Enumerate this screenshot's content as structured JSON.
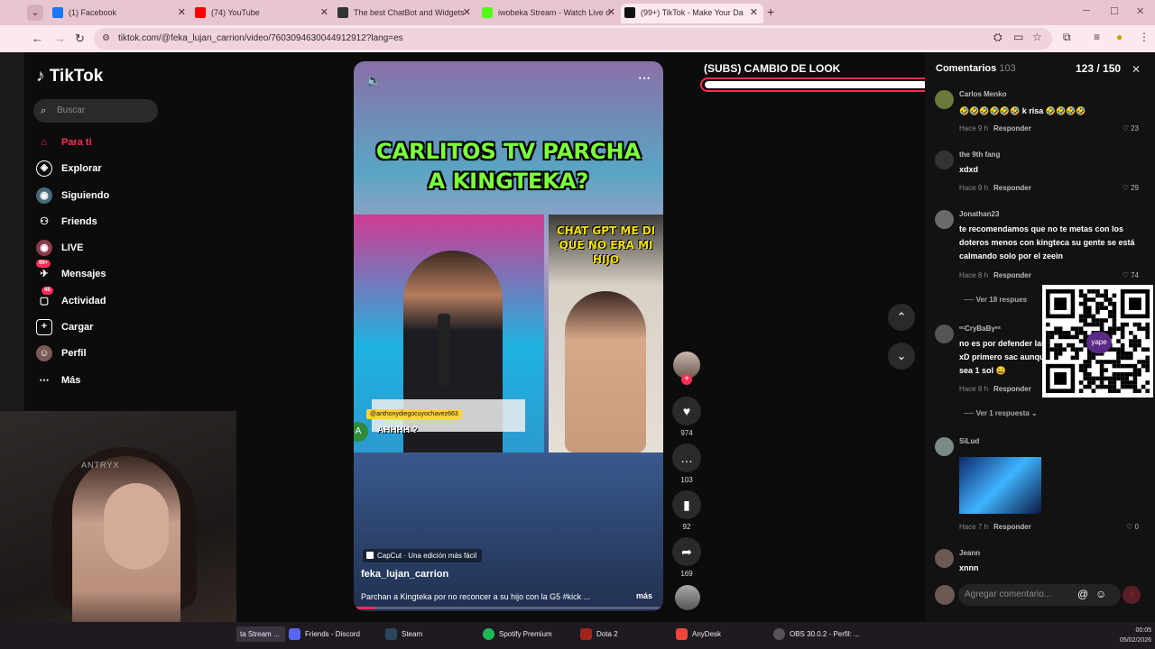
{
  "browser": {
    "tabs": [
      {
        "title": "(1) Facebook",
        "color": "#1877f2"
      },
      {
        "title": "(74) YouTube",
        "color": "#ff0000"
      },
      {
        "title": "The best ChatBot and Widgets",
        "color": "#333333"
      },
      {
        "title": "iwobeka Stream - Watch Live o",
        "color": "#53fc18"
      },
      {
        "title": "(99+) TikTok - Make Your Da",
        "color": "#111111"
      }
    ],
    "url": "tiktok.com/@feka_lujan_carrion/video/7603094630044912912?lang=es"
  },
  "sidebar": {
    "logo": "TikTok",
    "search_placeholder": "Buscar",
    "items": [
      {
        "label": "Para ti",
        "icon": "home-icon"
      },
      {
        "label": "Explorar",
        "icon": "compass-icon"
      },
      {
        "label": "Siguiendo",
        "icon": "following-icon"
      },
      {
        "label": "Friends",
        "icon": "friends-icon"
      },
      {
        "label": "LIVE",
        "icon": "live-icon"
      },
      {
        "label": "Mensajes",
        "icon": "messages-icon",
        "badge": "99+"
      },
      {
        "label": "Actividad",
        "icon": "activity-icon",
        "badge": "45"
      },
      {
        "label": "Cargar",
        "icon": "upload-icon"
      },
      {
        "label": "Perfil",
        "icon": "profile-icon"
      },
      {
        "label": "Más",
        "icon": "more-icon"
      }
    ]
  },
  "webcam": {
    "brand": "ANTRYX"
  },
  "video": {
    "headline_line1": "CARLITOS TV PARCHA",
    "headline_line2": "A KINGTEKA?",
    "caption_right_1": "CHAT GPT ME DI",
    "caption_right_2": "QUE NO ERA MI",
    "caption_right_3": "HIJO",
    "handle": "@anthonydiegocuyochavez663",
    "subtitle": "AHHHH ?",
    "capcut": "CapCut · Una edición más fácil",
    "author": "feka_lujan_carrion",
    "description": "Parchan a Kingteka por no reconcer a su hijo con la G5 #kick ...",
    "more": "más",
    "progress": 0.07
  },
  "actions": {
    "likes": "974",
    "comments": "103",
    "saves": "92",
    "shares": "169"
  },
  "goal": {
    "title": "(SUBS) CAMBIO DE LOOK",
    "current": "123",
    "total": "/ 150",
    "fraction": 0.82
  },
  "comments": {
    "title": "Comentarios",
    "count": "103",
    "placeholder": "Agregar comentario...",
    "reply_label": "Responder",
    "items": [
      {
        "user": "Carlos Menko",
        "text": "🤣🤣🤣🤣🤣🤣 k risa 🤣🤣🤣🤣",
        "time": "Hace 9 h",
        "likes": "23"
      },
      {
        "user": "the 9th fang",
        "text": "xdxd",
        "time": "Hace 9 h",
        "likes": "29"
      },
      {
        "user": "Jonathan23",
        "text": "te recomendamos que no te metas con los doteros menos con kingteca su gente se está calmando solo por el zeein",
        "time": "Hace 8 h",
        "likes": "74"
      },
      {
        "user": "ᵉᶜCryBaByᵉˢ",
        "text": "no es por defender laika xD primero sac aunque sea 1 sol 😄",
        "time": "Hace 8 h",
        "likes": ""
      },
      {
        "user": "SiLud",
        "text": "",
        "time": "Hace 7 h",
        "likes": "0"
      },
      {
        "user": "Jeann",
        "text": "xnnn",
        "time": "",
        "likes": ""
      }
    ],
    "view_replies_1": "Ver 18 respues",
    "view_replies_2": "Ver 1 respuesta ⌄"
  },
  "qr": {
    "label": "yape"
  },
  "taskbar": {
    "items": [
      {
        "label": "ta Stream ...",
        "color": "#53fc18"
      },
      {
        "label": "Friends - Discord",
        "color": "#5865f2"
      },
      {
        "label": "Steam",
        "color": "#1b2838"
      },
      {
        "label": "Spotify Premium",
        "color": "#1db954"
      },
      {
        "label": "Dota 2",
        "color": "#a0261c"
      },
      {
        "label": "AnyDesk",
        "color": "#ef443b"
      },
      {
        "label": "OBS 30.0.2 - Perfil: ...",
        "color": "#302e31"
      }
    ],
    "time": "00:05",
    "date": "05/02/2026"
  }
}
